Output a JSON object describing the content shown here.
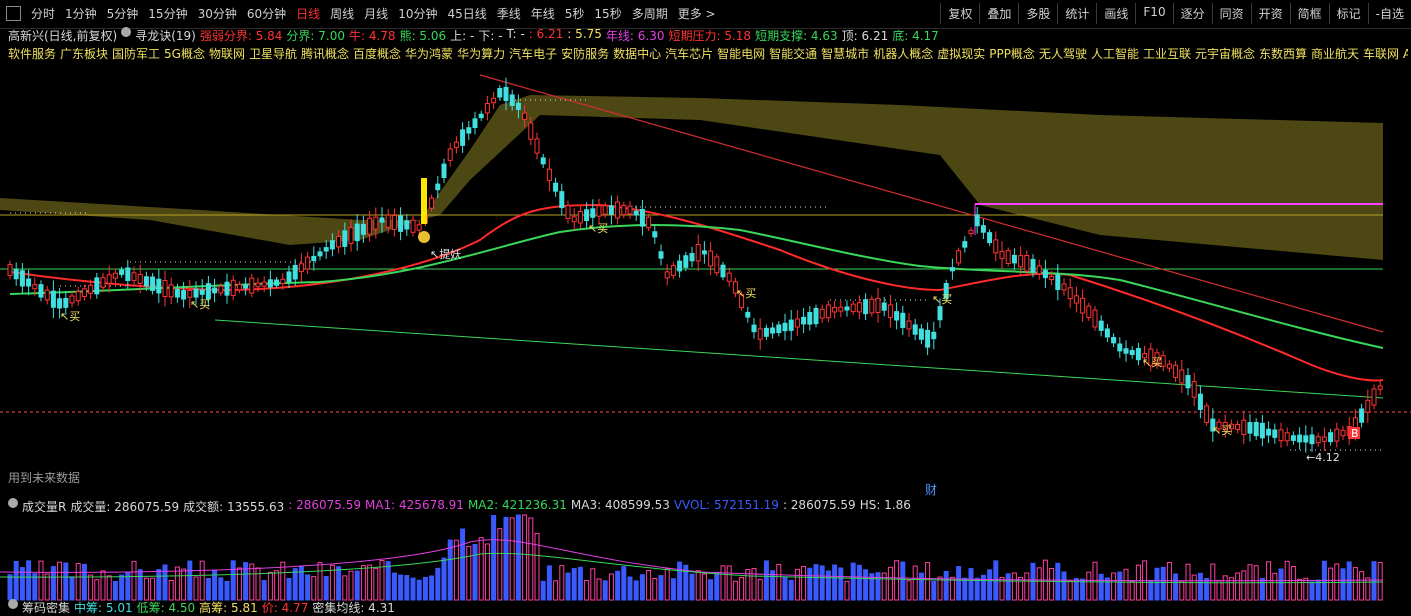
{
  "toolbar": {
    "periods": [
      "分时",
      "1分钟",
      "5分钟",
      "15分钟",
      "30分钟",
      "60分钟",
      "日线",
      "周线",
      "月线",
      "10分钟",
      "45日线",
      "季线",
      "年线",
      "5秒",
      "15秒",
      "多周期",
      "更多 >"
    ],
    "active_period": "日线",
    "right_buttons": [
      "复权",
      "叠加",
      "多股",
      "统计",
      "画线",
      "F10",
      "逐分",
      "同资",
      "开资",
      "简框",
      "标记",
      "-自选"
    ]
  },
  "info": {
    "title": "高新兴(日线,前复权)",
    "indicator": "寻龙诀(19)",
    "items": [
      {
        "text": "强弱分界: 5.84",
        "color": "#ff3333"
      },
      {
        "text": "分界: 7.00",
        "color": "#39d65a"
      },
      {
        "text": "牛: 4.78",
        "color": "#ff3333"
      },
      {
        "text": "熊: 5.06",
        "color": "#39d65a"
      },
      {
        "text": "上: -",
        "color": "#d8d8d8"
      },
      {
        "text": "下: -",
        "color": "#d8d8d8"
      },
      {
        "text": "T: -",
        "color": "#d8d8d8"
      },
      {
        "text": ": 6.21",
        "color": "#ff3333"
      },
      {
        "text": ": 5.75",
        "color": "#f0e060"
      },
      {
        "text": "年线: 6.30",
        "color": "#e040e0"
      },
      {
        "text": "短期压力: 5.18",
        "color": "#ff3333"
      },
      {
        "text": "短期支撑: 4.63",
        "color": "#39d65a"
      },
      {
        "text": "顶: 6.21",
        "color": "#d8d8d8"
      },
      {
        "text": "底: 4.17",
        "color": "#39d65a"
      }
    ]
  },
  "concepts": [
    "软件服务",
    "广东板块",
    "国防军工",
    "5G概念",
    "物联网",
    "卫星导航",
    "腾讯概念",
    "百度概念",
    "华为鸿蒙",
    "华为算力",
    "汽车电子",
    "安防服务",
    "数据中心",
    "汽车芯片",
    "智能电网",
    "智能交通",
    "智慧城市",
    "机器人概念",
    "虚拟现实",
    "PPP概念",
    "无人驾驶",
    "人工智能",
    "工业互联",
    "元宇宙概念",
    "东数西算",
    "商业航天",
    "车联网",
    "AI智能"
  ],
  "chart_labels": {
    "future_note": "用到未来数据",
    "cai_badge": "财",
    "tiyao": "提妖",
    "mai": "买",
    "low_price": "4.12",
    "b_marker": "B"
  },
  "volume": {
    "name": "成交量R",
    "items": [
      {
        "text": "成交量: 286075.59",
        "color": "#d8d8d8"
      },
      {
        "text": "成交额: 13555.63",
        "color": "#d8d8d8"
      },
      {
        "text": ": 286075.59",
        "color": "#e040e0"
      },
      {
        "text": "MA1: 425678.91",
        "color": "#e040e0"
      },
      {
        "text": "MA2: 421236.31",
        "color": "#39d65a"
      },
      {
        "text": "MA3: 408599.53",
        "color": "#d8d8d8"
      },
      {
        "text": "VVOL: 572151.19",
        "color": "#3a5aff"
      },
      {
        "text": ": 286075.59",
        "color": "#d8d8d8"
      },
      {
        "text": "HS: 1.86",
        "color": "#d8d8d8"
      }
    ]
  },
  "chips": {
    "name": "筹码密集",
    "items": [
      {
        "text": "中筹: 5.01",
        "color": "#40e0e0"
      },
      {
        "text": "低筹: 4.50",
        "color": "#39d65a"
      },
      {
        "text": "高筹: 5.81",
        "color": "#f0e060"
      },
      {
        "text": "价: 4.77",
        "color": "#ff3333"
      },
      {
        "text": "密集均线: 4.31",
        "color": "#d8d8d8"
      }
    ]
  },
  "colors": {
    "up": "#ff3333",
    "down": "#40e0e0",
    "ma_red": "#ff2a2a",
    "ma_green": "#39d65a",
    "band": "#5a5418",
    "pink_line": "#ff40ff"
  }
}
